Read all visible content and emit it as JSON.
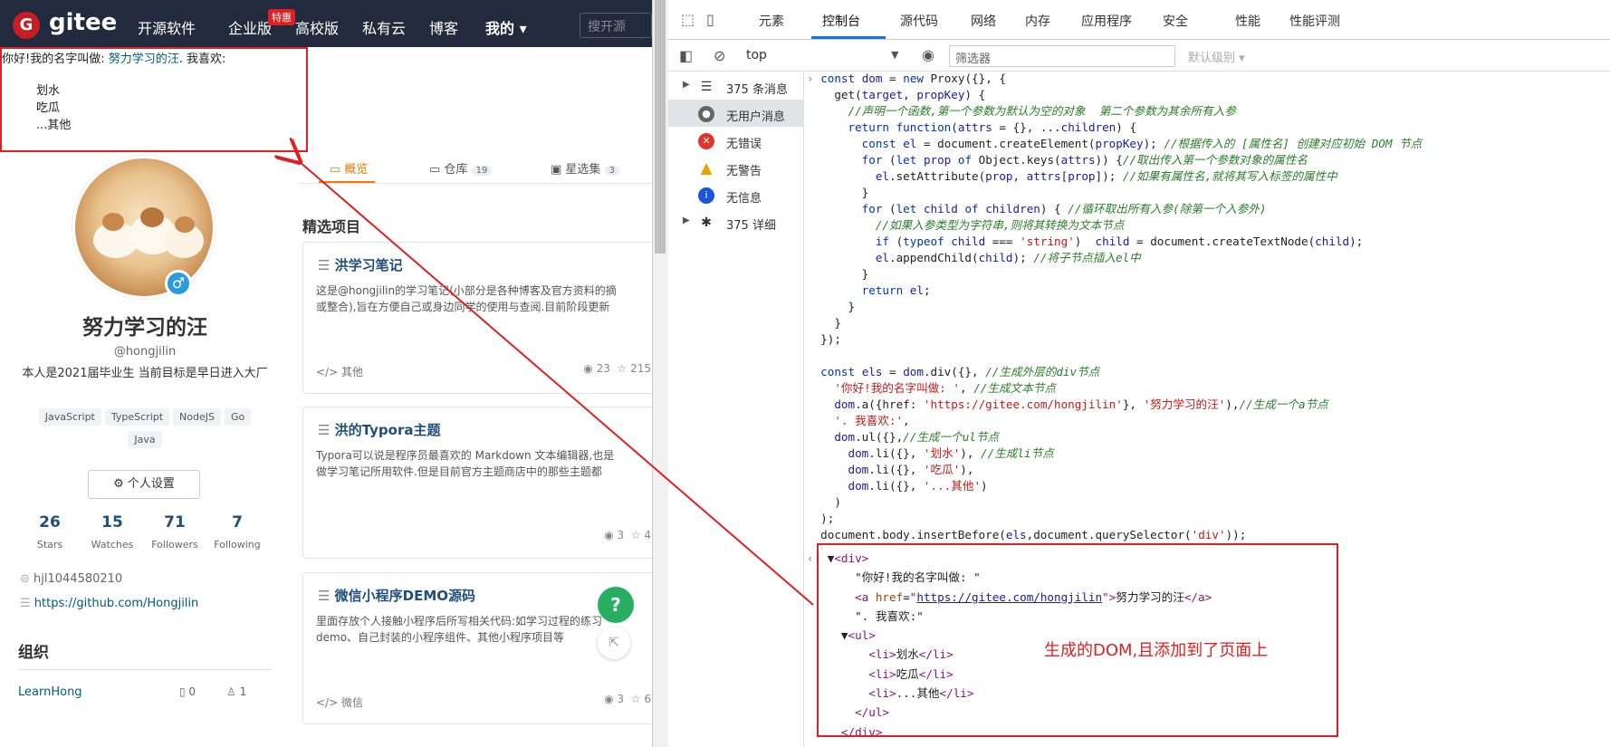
{
  "gitee": {
    "logo_letter": "G",
    "logo_text": "gitee",
    "nav": [
      "开源软件",
      "企业版",
      "高校版",
      "私有云",
      "博客",
      "我的 ▾"
    ],
    "hot_badge": "特惠",
    "search_placeholder": "搜开源"
  },
  "injected": {
    "prefix": "你好!我的名字叫做: ",
    "link_text": "努力学习的汪",
    "suffix": ". 我喜欢:",
    "items": [
      "划水",
      "吃瓜",
      "...其他"
    ]
  },
  "profile": {
    "name": "努力学习的汪",
    "username": "@hongjilin",
    "bio": "本人是2021届毕业生 当前目标是早日进入大厂",
    "tags": [
      "JavaScript",
      "TypeScript",
      "NodeJS",
      "Go",
      "Java"
    ],
    "settings": "⚙ 个人设置",
    "stats": [
      {
        "n": "26",
        "l": "Stars"
      },
      {
        "n": "15",
        "l": "Watches"
      },
      {
        "n": "71",
        "l": "Followers"
      },
      {
        "n": "7",
        "l": "Following"
      }
    ],
    "wechat": "hjl1044580210",
    "github": "https://github.com/Hongjilin",
    "org_title": "组织",
    "org_name": "LearnHong",
    "org_repos": "0",
    "org_members": "1"
  },
  "tabs": [
    {
      "label": "概览"
    },
    {
      "label": "仓库",
      "count": "19"
    },
    {
      "label": "星选集",
      "count": "3"
    }
  ],
  "section_title": "精选项目",
  "cards": [
    {
      "title": "洪学习笔记",
      "desc1": "这是@hongjilin的学习笔记(小部分是各种博客及官方资料的摘",
      "desc2": "或整合),旨在方便自己或身边同学的使用与查阅.目前阶段更新",
      "lang": "其他",
      "views": "23",
      "stars": "215"
    },
    {
      "title": "洪的Typora主题",
      "desc1": "Typora可以说是程序员最喜欢的 Markdown 文本编辑器,也是",
      "desc2": "做学习笔记所用软件.但是目前官方主题商店中的那些主题都",
      "lang": "",
      "views": "3",
      "stars": "4"
    },
    {
      "title": "微信小程序DEMO源码",
      "desc1": "里面存放个人接触小程序后所写相关代码:如学习过程的练习",
      "desc2": "demo、自己封装的小程序组件、其他小程序项目等",
      "lang": "微信",
      "views": "3",
      "stars": "6"
    }
  ],
  "help": "?",
  "devtools": {
    "tabs": [
      "元素",
      "控制台",
      "源代码",
      "网络",
      "内存",
      "应用程序",
      "安全",
      "性能",
      "性能评测"
    ],
    "context": "top",
    "filter": "筛选器",
    "level": "默认级别 ▾",
    "sidebar": [
      {
        "label": "375 条消息",
        "icon": "list"
      },
      {
        "label": "无用户消息",
        "icon": "user"
      },
      {
        "label": "无错误",
        "icon": "error"
      },
      {
        "label": "无警告",
        "icon": "warning"
      },
      {
        "label": "无信息",
        "icon": "info"
      },
      {
        "label": "375 详细",
        "icon": "bug"
      }
    ]
  },
  "note": "生成的DOM,且添加到了页面上",
  "colors": {
    "accent": "#fe7300",
    "link": "#005980",
    "devtools_accent": "#1a73e8",
    "annotation": "#e02020"
  }
}
